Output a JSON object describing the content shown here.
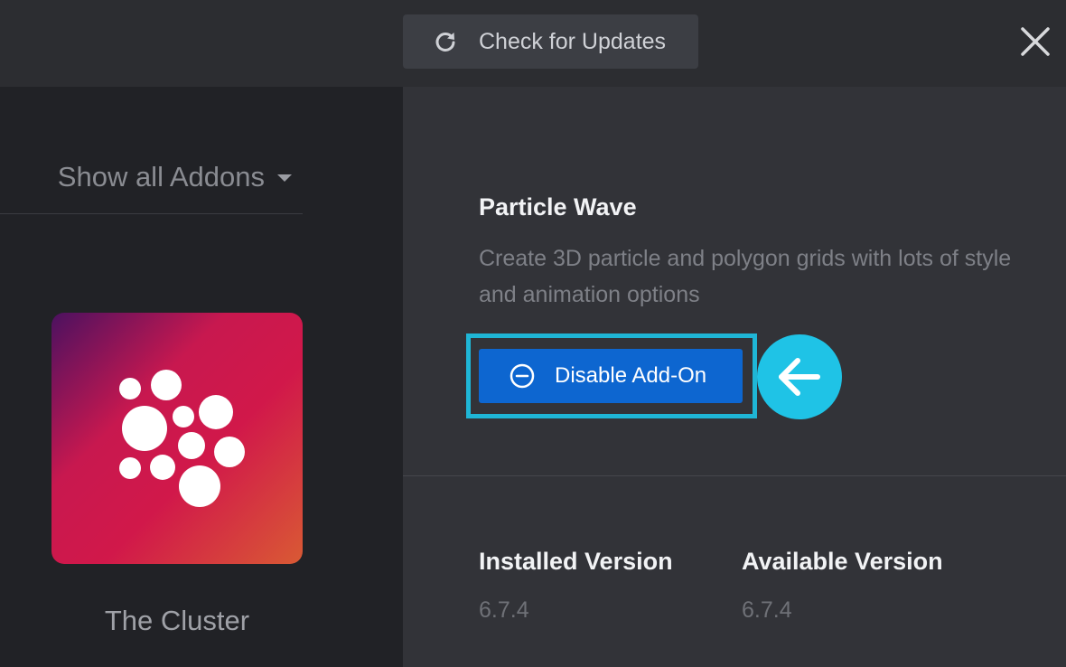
{
  "header": {
    "check_updates_label": "Check for Updates",
    "check_updates_icon": "refresh-icon",
    "close_icon": "close-icon"
  },
  "sidebar": {
    "filter_label": "Show all Addons",
    "filter_icon": "caret-down-icon",
    "addon": {
      "name": "The Cluster",
      "thumbnail_icon": "cluster-dots-icon"
    }
  },
  "detail": {
    "title": "Particle Wave",
    "description": "Create 3D particle and polygon grids with lots of style and animation options",
    "disable_button_label": "Disable Add-On",
    "disable_button_icon": "minus-circle-icon",
    "callout_icon": "arrow-left-icon",
    "installed_version_label": "Installed Version",
    "installed_version_value": "6.7.4",
    "available_version_label": "Available Version",
    "available_version_value": "6.7.4"
  },
  "colors": {
    "accent_blue": "#0d66d0",
    "callout_cyan": "#1fc3e6",
    "panel_dark": "#212226",
    "panel_main": "#323338"
  }
}
